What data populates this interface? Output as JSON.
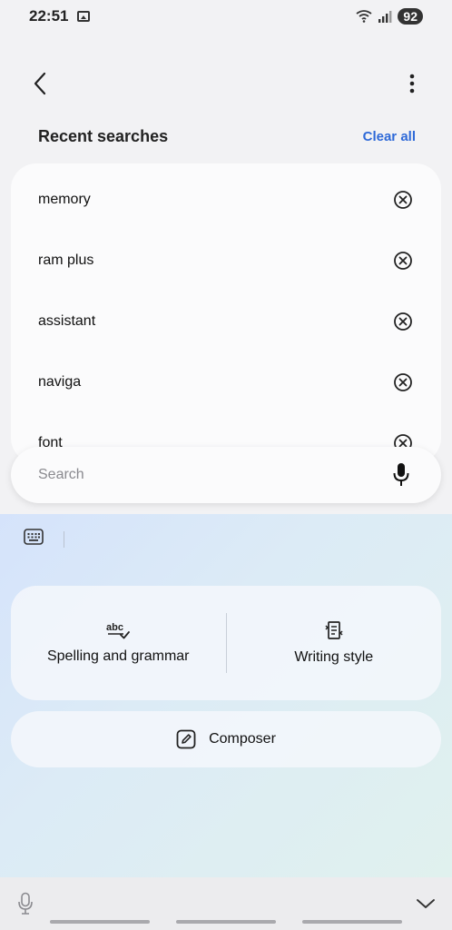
{
  "status_bar": {
    "time": "22:51",
    "battery": "92",
    "icons": [
      "image-icon",
      "wifi-icon",
      "signal-icon"
    ]
  },
  "header": {
    "back_icon": "back-arrow-icon",
    "menu_icon": "more-vertical-icon"
  },
  "recent": {
    "title": "Recent searches",
    "clear_label": "Clear all",
    "items": [
      {
        "label": "memory"
      },
      {
        "label": "ram plus"
      },
      {
        "label": "assistant"
      },
      {
        "label": "naviga"
      },
      {
        "label": "font"
      }
    ],
    "remove_icon": "clear-circle-icon"
  },
  "search": {
    "placeholder": "Search",
    "value": "",
    "mic_icon": "mic-icon"
  },
  "keyboard": {
    "toolbar_icon": "keyboard-icon",
    "options": [
      {
        "label": "Spelling and grammar",
        "icon": "spellcheck-icon"
      },
      {
        "label": "Writing style",
        "icon": "writing-style-icon"
      }
    ],
    "composer": {
      "label": "Composer",
      "icon": "compose-icon"
    },
    "voice_icon": "mic-outline-icon",
    "hide_icon": "chevron-down-icon"
  },
  "colors": {
    "accent": "#2f6ad8",
    "background": "#f2f2f4",
    "card": "#fbfbfc"
  }
}
